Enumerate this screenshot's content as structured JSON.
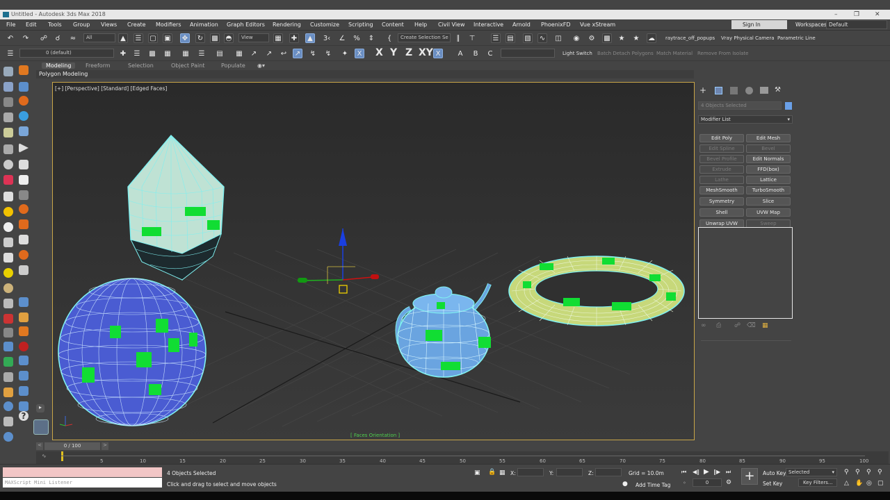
{
  "window": {
    "title": "Untitled - Autodesk 3ds Max 2018"
  },
  "menu": [
    "File",
    "Edit",
    "Tools",
    "Group",
    "Views",
    "Create",
    "Modifiers",
    "Animation",
    "Graph Editors",
    "Rendering",
    "Customize",
    "Scripting",
    "Content",
    "Help",
    "Civil View",
    "Interactive",
    "Arnold",
    "PhoenixFD",
    "Vue xStream"
  ],
  "account": {
    "sign_in": "Sign In",
    "workspaces_label": "Workspaces:",
    "workspace": "Default"
  },
  "toolbar1": {
    "filter": "All",
    "view": "View",
    "selection_set": "Create Selection Se",
    "raytrace": "raytrace_off_popups",
    "vray_camera": "Vray Physical Camera",
    "parametric_line": "Parametric Line"
  },
  "toolbar2": {
    "layer": "0 (default)",
    "axes": [
      "X",
      "Y",
      "Z",
      "XY"
    ],
    "light_switch": "Light Switch",
    "batch_detach": "Batch Detach Polygons",
    "match_material": "Match Material",
    "remove_isolate": "Remove From Isolate"
  },
  "ribbon": {
    "tabs": [
      "Modeling",
      "Freeform",
      "Selection",
      "Object Paint",
      "Populate"
    ],
    "active": "Modeling",
    "sub": "Polygon Modeling"
  },
  "viewport": {
    "label": "[+] [Perspective] [Standard] [Edged Faces]",
    "footer": "[ Faces Orientation ]"
  },
  "panel": {
    "selection": "4 Objects Selected",
    "modifier_list": "Modifier List",
    "buttons": [
      {
        "label": "Edit Poly",
        "enabled": true
      },
      {
        "label": "Edit Mesh",
        "enabled": true
      },
      {
        "label": "Edit Spline",
        "enabled": false
      },
      {
        "label": "Bevel",
        "enabled": false
      },
      {
        "label": "Bevel Profile",
        "enabled": false
      },
      {
        "label": "Edit Normals",
        "enabled": true
      },
      {
        "label": "Extrude",
        "enabled": false
      },
      {
        "label": "FFD(box)",
        "enabled": true
      },
      {
        "label": "Lathe",
        "enabled": false
      },
      {
        "label": "Lattice",
        "enabled": true
      },
      {
        "label": "MeshSmooth",
        "enabled": true
      },
      {
        "label": "TurboSmooth",
        "enabled": true
      },
      {
        "label": "Symmetry",
        "enabled": true
      },
      {
        "label": "Slice",
        "enabled": true
      },
      {
        "label": "Shell",
        "enabled": true
      },
      {
        "label": "UVW Map",
        "enabled": true
      },
      {
        "label": "Unwrap UVW",
        "enabled": true
      },
      {
        "label": "Sweep",
        "enabled": false
      }
    ]
  },
  "timeline": {
    "frame": "0 / 100",
    "ticks": [
      "5",
      "10",
      "15",
      "20",
      "25",
      "30",
      "35",
      "40",
      "45",
      "50",
      "55",
      "60",
      "65",
      "70",
      "75",
      "80",
      "85",
      "90",
      "95",
      "100"
    ]
  },
  "status": {
    "listener": "MAXScript Mini Listener",
    "selected": "4 Objects Selected",
    "prompt": "Click and drag to select and move objects",
    "x_label": "X:",
    "y_label": "Y:",
    "z_label": "Z:",
    "grid": "Grid = 10.0m",
    "add_time_tag": "Add Time Tag",
    "auto_key": "Auto Key",
    "set_key": "Set Key",
    "key_mode": "Selected",
    "key_filters": "Key Filters...",
    "current_frame": "0"
  },
  "colors": {
    "accent": "#6a8ec2",
    "viewport_border": "#c9a648",
    "wire": "#7ff0f0",
    "marker": "#11dd33"
  }
}
